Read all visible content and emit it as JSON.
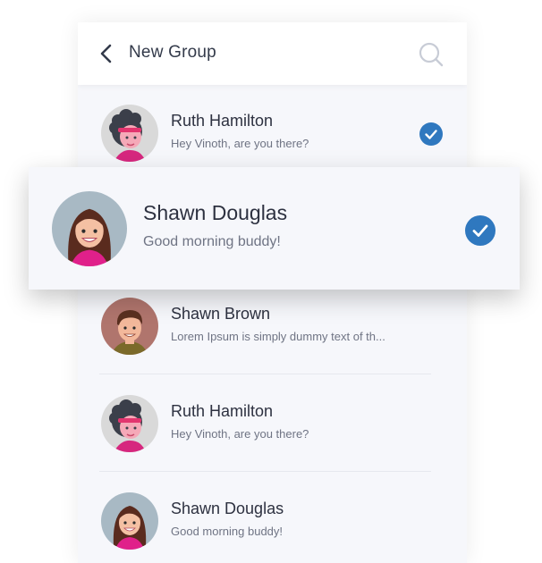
{
  "header": {
    "title": "New Group",
    "back_icon": "chevron-left-icon",
    "search_icon": "search-icon"
  },
  "contacts": [
    {
      "name": "Ruth Hamilton",
      "message": "Hey Vinoth, are you there?",
      "selected": true,
      "avatar": "woman-curly-hair"
    },
    {
      "name": "Shawn Brown",
      "message": "Lorem Ipsum is simply dummy text of th...",
      "selected": false,
      "avatar": "man-brown-hair"
    },
    {
      "name": "Ruth Hamilton",
      "message": "Hey Vinoth, are you there?",
      "selected": false,
      "avatar": "woman-curly-hair"
    },
    {
      "name": "Shawn Douglas",
      "message": "Good morning buddy!",
      "selected": false,
      "avatar": "woman-long-hair"
    }
  ],
  "highlighted": {
    "name": "Shawn Douglas",
    "message": "Good morning buddy!",
    "selected": true,
    "avatar": "woman-long-hair"
  },
  "colors": {
    "accent": "#2f78bf",
    "background": "#f6f7fb",
    "header": "#ffffff"
  }
}
